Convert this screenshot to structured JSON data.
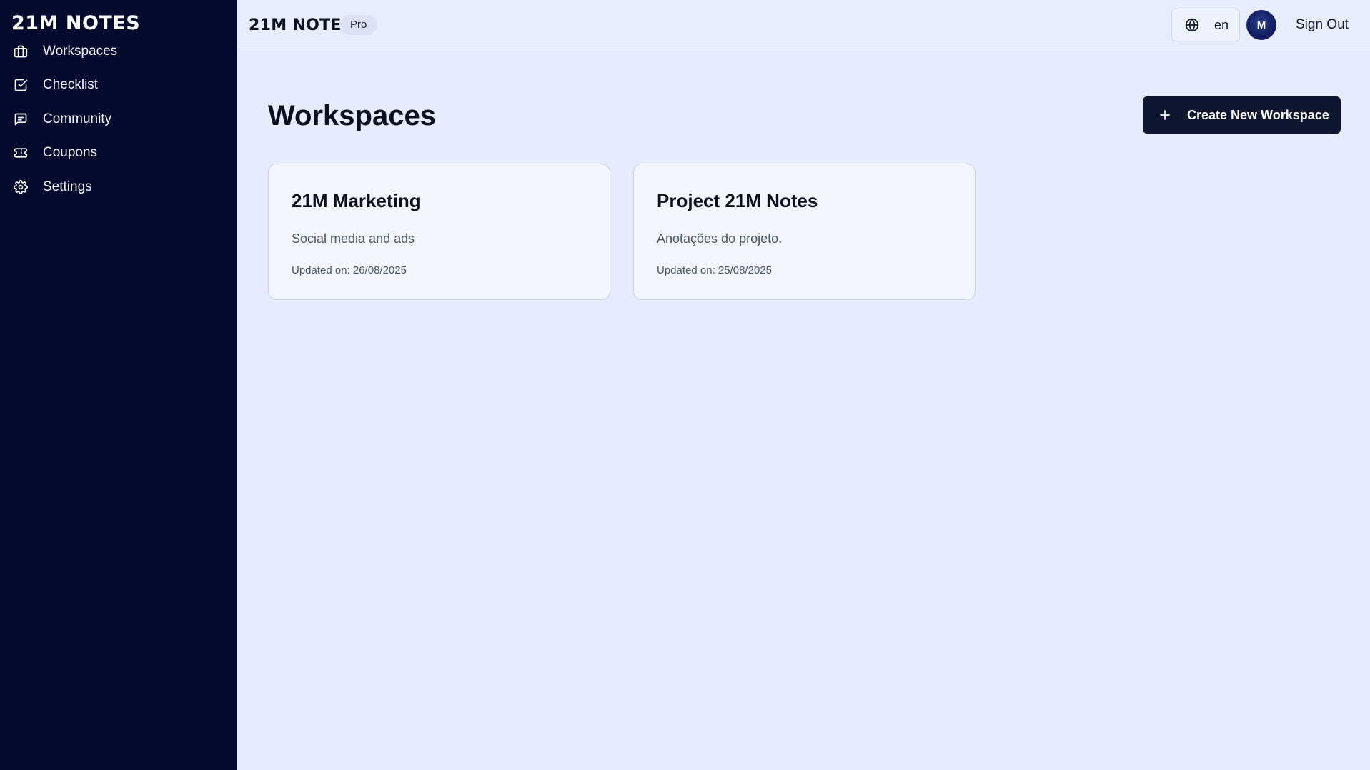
{
  "app": {
    "logo_text": "21M NOTES",
    "brand_text": "21M NOTES",
    "plan_badge": "Pro"
  },
  "sidebar": {
    "items": [
      {
        "label": "Workspaces",
        "icon": "briefcase-icon"
      },
      {
        "label": "Checklist",
        "icon": "check-square-icon"
      },
      {
        "label": "Community",
        "icon": "message-square-icon"
      },
      {
        "label": "Coupons",
        "icon": "ticket-icon"
      },
      {
        "label": "Settings",
        "icon": "gear-icon"
      }
    ]
  },
  "header": {
    "language": "en",
    "avatar_initial": "M",
    "sign_out_label": "Sign Out"
  },
  "main": {
    "title": "Workspaces",
    "create_button_label": "Create New Workspace",
    "workspaces": [
      {
        "title": "21M Marketing",
        "description": "Social media and ads",
        "updated": "Updated on: 26/08/2025"
      },
      {
        "title": "Project 21M Notes",
        "description": "Anotações do projeto.",
        "updated": "Updated on: 25/08/2025"
      }
    ]
  },
  "colors": {
    "sidebar_bg": "#020a2e",
    "page_bg": "#e6ebfd",
    "card_bg": "#f3f6fe",
    "primary_button": "#0f1730"
  }
}
